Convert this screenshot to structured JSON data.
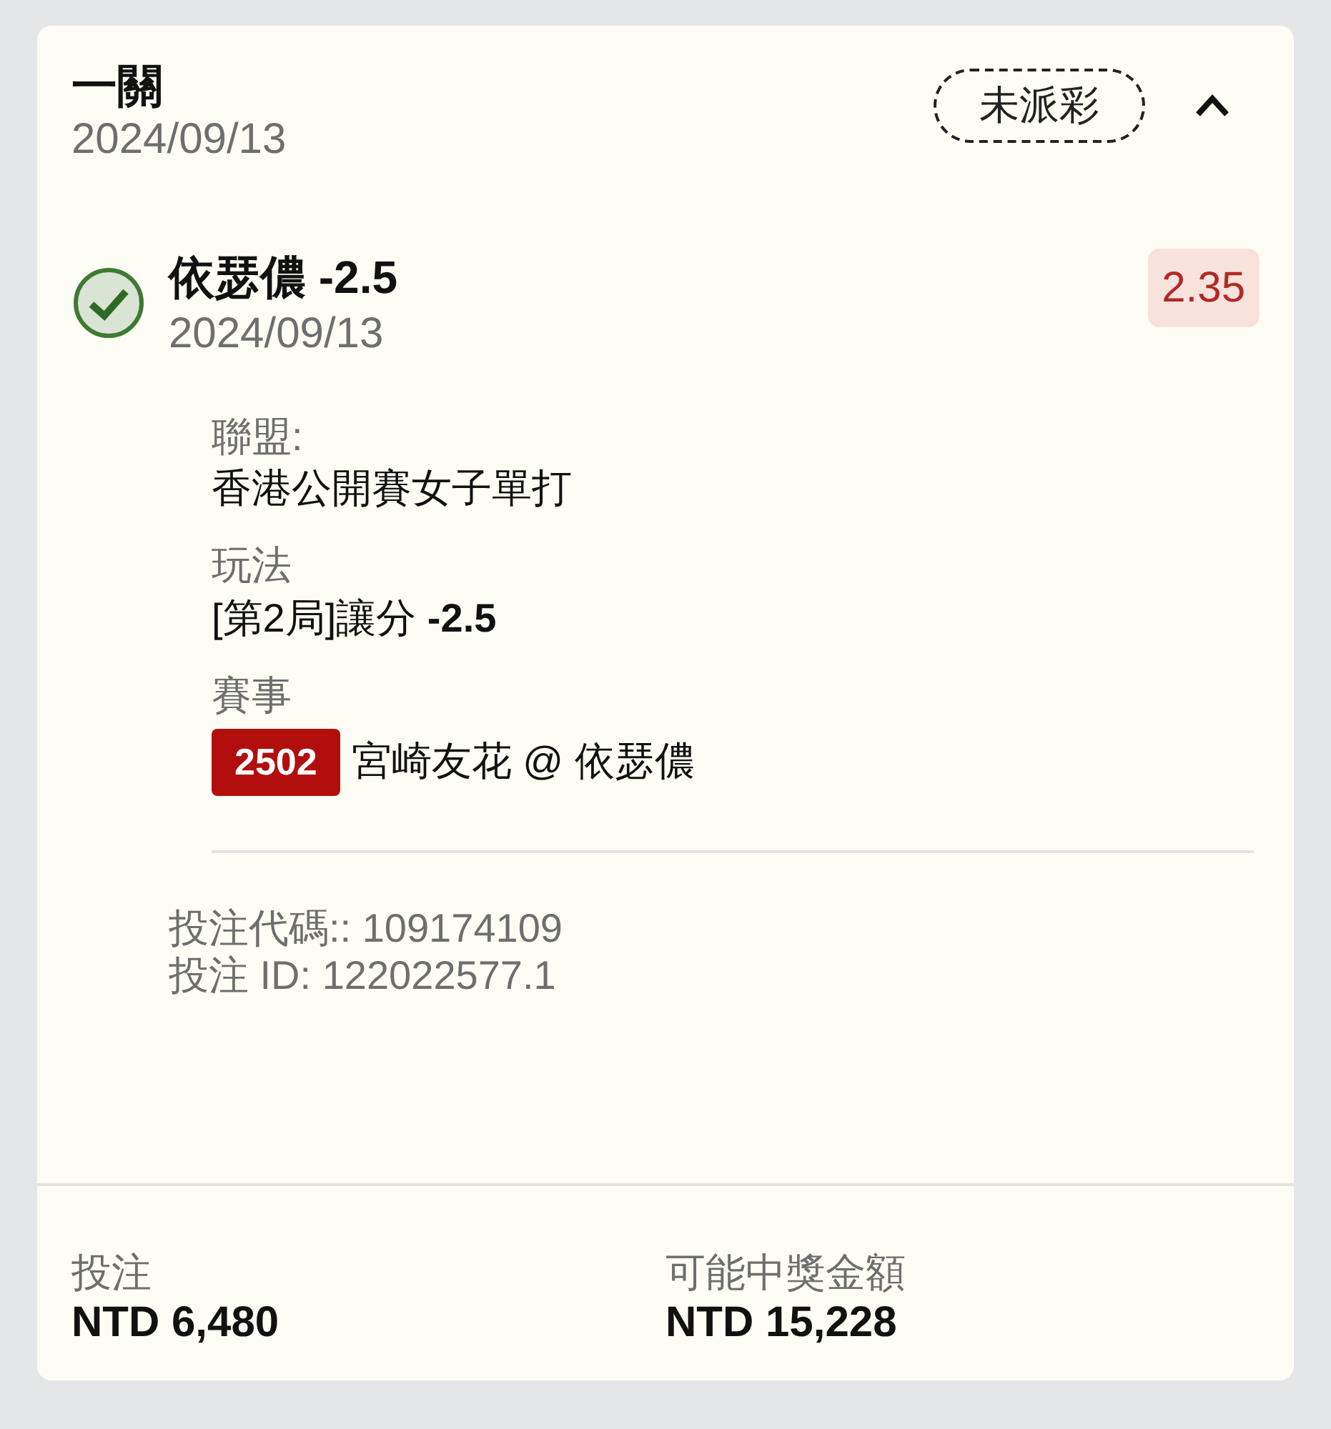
{
  "bet": {
    "title": "一關",
    "date": "2024/09/13",
    "status": "未派彩",
    "expanded": true
  },
  "selection": {
    "checked": true,
    "name": "依瑟儂 -2.5",
    "date": "2024/09/13",
    "odds": "2.35",
    "details": [
      {
        "kind": "text",
        "label": "聯盟:",
        "value": "香港公開賽女子單打"
      },
      {
        "kind": "text",
        "label": "玩法",
        "value": "[第2局]讓分 **-2.5**"
      },
      {
        "kind": "event",
        "label": "賽事",
        "code": "2502",
        "value": "宮崎友花 @ 依瑟儂"
      }
    ],
    "refs": [
      "投注代碼:: 109174109",
      "投注 ID: 122022577.1"
    ]
  },
  "footer": [
    {
      "label": "投注",
      "value": "NTD 6,480"
    },
    {
      "label": "可能中獎金額",
      "value": "NTD 15,228"
    }
  ]
}
